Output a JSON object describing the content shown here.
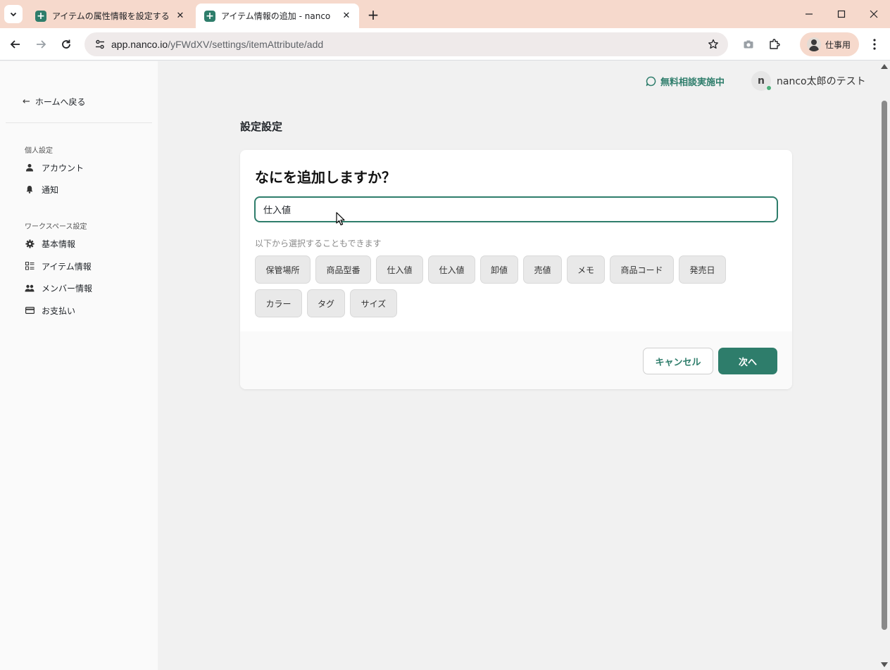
{
  "browser": {
    "tabs": [
      {
        "title": "アイテムの属性情報を設定する",
        "active": false
      },
      {
        "title": "アイテム情報の追加 - nanco",
        "active": true
      }
    ],
    "url_host": "app.nanco.io",
    "url_path": "/yFWdXV/settings/itemAttribute/add",
    "profile_label": "仕事用"
  },
  "sidebar": {
    "back_label": "ホームへ戻る",
    "personal_section": "個人設定",
    "personal_items": [
      {
        "label": "アカウント",
        "icon": "person-icon"
      },
      {
        "label": "通知",
        "icon": "bell-icon"
      }
    ],
    "workspace_section": "ワークスペース設定",
    "workspace_items": [
      {
        "label": "基本情報",
        "icon": "gear-icon"
      },
      {
        "label": "アイテム情報",
        "icon": "list-icon"
      },
      {
        "label": "メンバー情報",
        "icon": "group-icon"
      },
      {
        "label": "お支払い",
        "icon": "credit-card-icon"
      }
    ]
  },
  "header": {
    "consult_label": "無料相談実施中",
    "user_initial": "n",
    "user_name": "nanco太郎のテスト"
  },
  "main": {
    "page_title": "設定設定",
    "card": {
      "heading": "なにを追加しますか？",
      "input_value": "仕入値",
      "hint": "以下から選択することもできます",
      "chips": [
        "保管場所",
        "商品型番",
        "仕入値",
        "仕入値",
        "卸値",
        "売値",
        "メモ",
        "商品コード",
        "発売日",
        "カラー",
        "タグ",
        "サイズ"
      ],
      "cancel_label": "キャンセル",
      "next_label": "次へ"
    }
  },
  "colors": {
    "accent": "#2e7d6b",
    "tabbar": "#f6d9cc"
  }
}
